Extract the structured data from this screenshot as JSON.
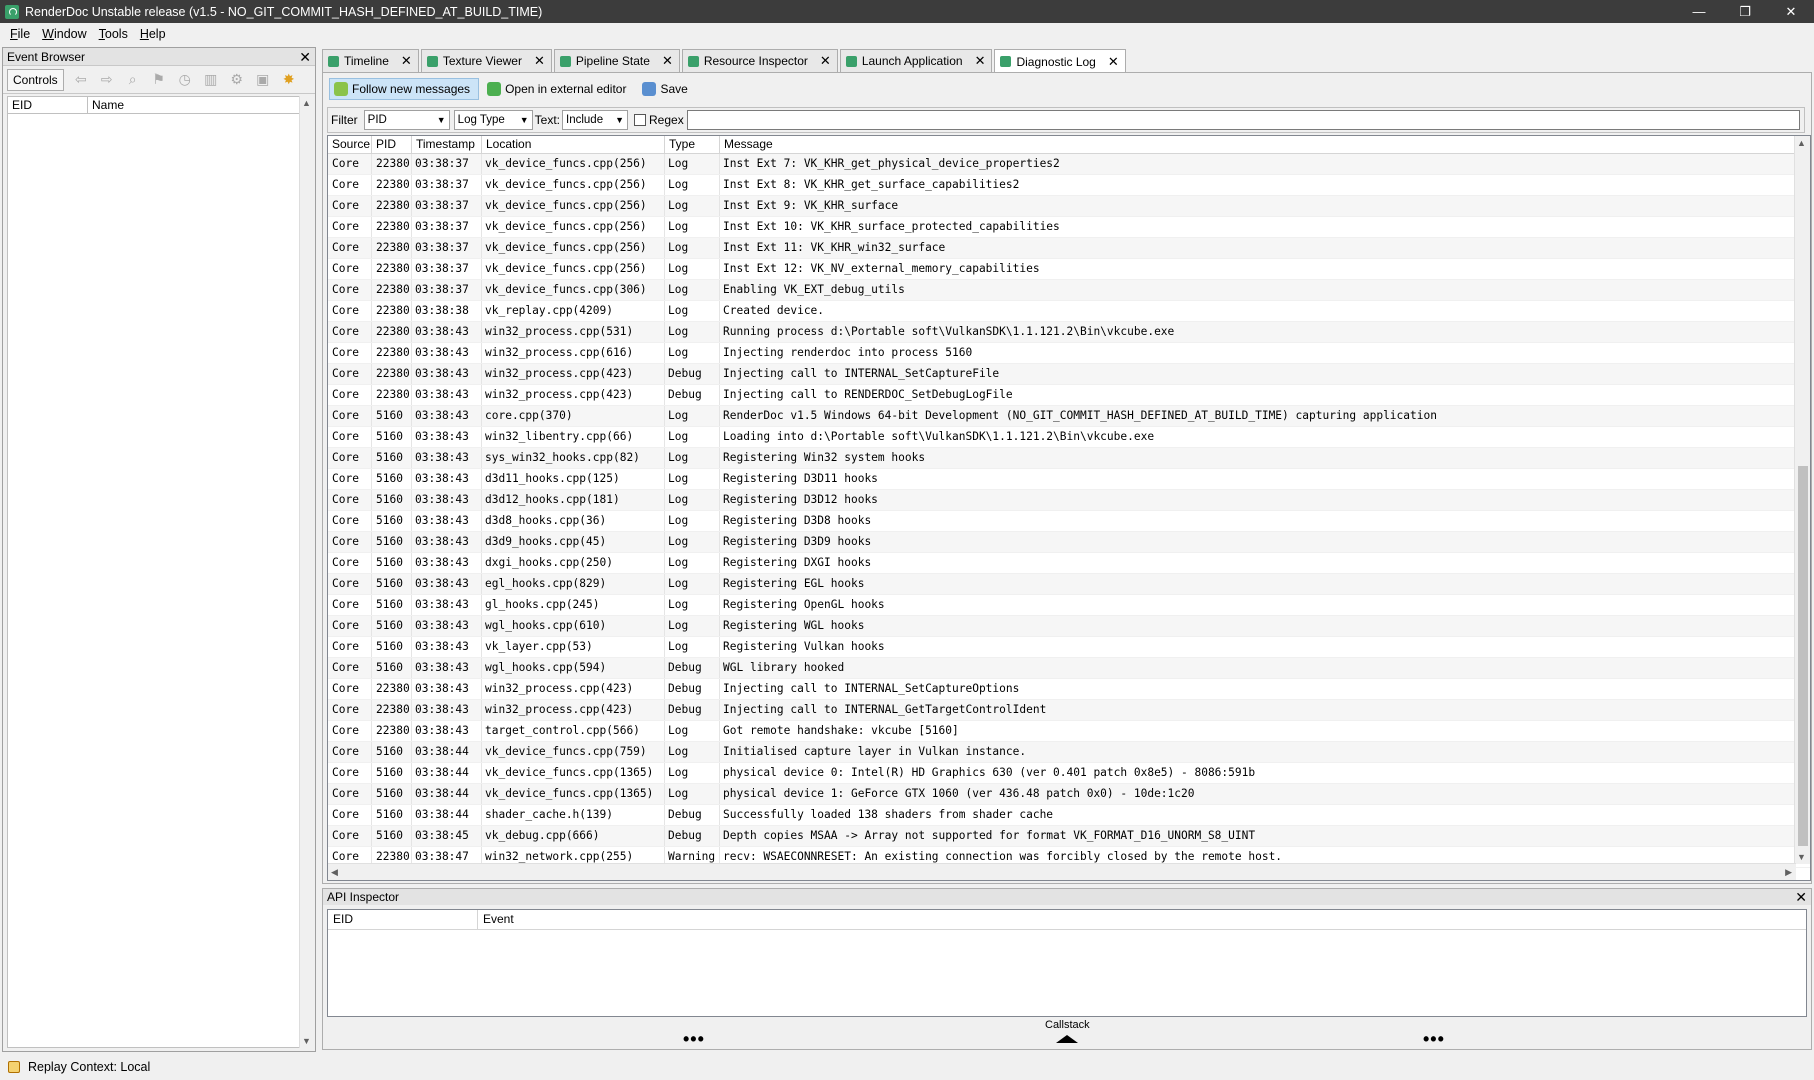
{
  "window": {
    "title": "RenderDoc Unstable release (v1.5 - NO_GIT_COMMIT_HASH_DEFINED_AT_BUILD_TIME)",
    "min": "—",
    "max": "❐",
    "close": "✕"
  },
  "menu": [
    "File",
    "Window",
    "Tools",
    "Help"
  ],
  "event_browser": {
    "title": "Event Browser",
    "controls_label": "Controls",
    "columns": [
      "EID",
      "Name"
    ]
  },
  "status": {
    "text": "Replay Context: Local"
  },
  "tabs": [
    {
      "label": "Timeline"
    },
    {
      "label": "Texture Viewer"
    },
    {
      "label": "Pipeline State"
    },
    {
      "label": "Resource Inspector"
    },
    {
      "label": "Launch Application"
    },
    {
      "label": "Diagnostic Log"
    }
  ],
  "toolbar": {
    "follow": "Follow new messages",
    "external": "Open in external editor",
    "save": "Save"
  },
  "filter": {
    "label": "Filter",
    "pid": "PID",
    "logtype": "Log Type",
    "text_label": "Text:",
    "include": "Include",
    "regex": "Regex"
  },
  "log": {
    "columns": [
      "Source",
      "PID",
      "Timestamp",
      "Location",
      "Type",
      "Message"
    ],
    "rows": [
      [
        "Core",
        "22380",
        "03:38:37",
        "vk_device_funcs.cpp(256)",
        "Log",
        "Inst Ext 7: VK_KHR_get_physical_device_properties2"
      ],
      [
        "Core",
        "22380",
        "03:38:37",
        "vk_device_funcs.cpp(256)",
        "Log",
        "Inst Ext 8: VK_KHR_get_surface_capabilities2"
      ],
      [
        "Core",
        "22380",
        "03:38:37",
        "vk_device_funcs.cpp(256)",
        "Log",
        "Inst Ext 9: VK_KHR_surface"
      ],
      [
        "Core",
        "22380",
        "03:38:37",
        "vk_device_funcs.cpp(256)",
        "Log",
        "Inst Ext 10: VK_KHR_surface_protected_capabilities"
      ],
      [
        "Core",
        "22380",
        "03:38:37",
        "vk_device_funcs.cpp(256)",
        "Log",
        "Inst Ext 11: VK_KHR_win32_surface"
      ],
      [
        "Core",
        "22380",
        "03:38:37",
        "vk_device_funcs.cpp(256)",
        "Log",
        "Inst Ext 12: VK_NV_external_memory_capabilities"
      ],
      [
        "Core",
        "22380",
        "03:38:37",
        "vk_device_funcs.cpp(306)",
        "Log",
        "Enabling VK_EXT_debug_utils"
      ],
      [
        "Core",
        "22380",
        "03:38:38",
        "vk_replay.cpp(4209)",
        "Log",
        "Created device."
      ],
      [
        "Core",
        "22380",
        "03:38:43",
        "win32_process.cpp(531)",
        "Log",
        "Running process d:\\Portable soft\\VulkanSDK\\1.1.121.2\\Bin\\vkcube.exe"
      ],
      [
        "Core",
        "22380",
        "03:38:43",
        "win32_process.cpp(616)",
        "Log",
        "Injecting renderdoc into process 5160"
      ],
      [
        "Core",
        "22380",
        "03:38:43",
        "win32_process.cpp(423)",
        "Debug",
        "Injecting call to INTERNAL_SetCaptureFile"
      ],
      [
        "Core",
        "22380",
        "03:38:43",
        "win32_process.cpp(423)",
        "Debug",
        "Injecting call to RENDERDOC_SetDebugLogFile"
      ],
      [
        "Core",
        "5160",
        "03:38:43",
        "core.cpp(370)",
        "Log",
        "RenderDoc v1.5 Windows 64-bit Development (NO_GIT_COMMIT_HASH_DEFINED_AT_BUILD_TIME) capturing application"
      ],
      [
        "Core",
        "5160",
        "03:38:43",
        "win32_libentry.cpp(66)",
        "Log",
        "Loading into d:\\Portable soft\\VulkanSDK\\1.1.121.2\\Bin\\vkcube.exe"
      ],
      [
        "Core",
        "5160",
        "03:38:43",
        "sys_win32_hooks.cpp(82)",
        "Log",
        "Registering Win32 system hooks"
      ],
      [
        "Core",
        "5160",
        "03:38:43",
        "d3d11_hooks.cpp(125)",
        "Log",
        "Registering D3D11 hooks"
      ],
      [
        "Core",
        "5160",
        "03:38:43",
        "d3d12_hooks.cpp(181)",
        "Log",
        "Registering D3D12 hooks"
      ],
      [
        "Core",
        "5160",
        "03:38:43",
        "d3d8_hooks.cpp(36)",
        "Log",
        "Registering D3D8 hooks"
      ],
      [
        "Core",
        "5160",
        "03:38:43",
        "d3d9_hooks.cpp(45)",
        "Log",
        "Registering D3D9 hooks"
      ],
      [
        "Core",
        "5160",
        "03:38:43",
        "dxgi_hooks.cpp(250)",
        "Log",
        "Registering DXGI hooks"
      ],
      [
        "Core",
        "5160",
        "03:38:43",
        "egl_hooks.cpp(829)",
        "Log",
        "Registering EGL hooks"
      ],
      [
        "Core",
        "5160",
        "03:38:43",
        "gl_hooks.cpp(245)",
        "Log",
        "Registering OpenGL hooks"
      ],
      [
        "Core",
        "5160",
        "03:38:43",
        "wgl_hooks.cpp(610)",
        "Log",
        "Registering WGL hooks"
      ],
      [
        "Core",
        "5160",
        "03:38:43",
        "vk_layer.cpp(53)",
        "Log",
        "Registering Vulkan hooks"
      ],
      [
        "Core",
        "5160",
        "03:38:43",
        "wgl_hooks.cpp(594)",
        "Debug",
        "WGL library hooked"
      ],
      [
        "Core",
        "22380",
        "03:38:43",
        "win32_process.cpp(423)",
        "Debug",
        "Injecting call to INTERNAL_SetCaptureOptions"
      ],
      [
        "Core",
        "22380",
        "03:38:43",
        "win32_process.cpp(423)",
        "Debug",
        "Injecting call to INTERNAL_GetTargetControlIdent"
      ],
      [
        "Core",
        "22380",
        "03:38:43",
        "target_control.cpp(566)",
        "Log",
        "Got remote handshake: vkcube [5160]"
      ],
      [
        "Core",
        "5160",
        "03:38:44",
        "vk_device_funcs.cpp(759)",
        "Log",
        "Initialised capture layer in Vulkan instance."
      ],
      [
        "Core",
        "5160",
        "03:38:44",
        "vk_device_funcs.cpp(1365)",
        "Log",
        "physical device 0: Intel(R) HD Graphics 630 (ver 0.401 patch 0x8e5) - 8086:591b"
      ],
      [
        "Core",
        "5160",
        "03:38:44",
        "vk_device_funcs.cpp(1365)",
        "Log",
        "physical device 1: GeForce GTX 1060 (ver 436.48 patch 0x0) - 10de:1c20"
      ],
      [
        "Core",
        "5160",
        "03:38:44",
        "shader_cache.h(139)",
        "Debug",
        "Successfully loaded 138 shaders from shader cache"
      ],
      [
        "Core",
        "5160",
        "03:38:45",
        "vk_debug.cpp(666)",
        "Debug",
        "Depth copies MSAA -> Array not supported for format VK_FORMAT_D16_UNORM_S8_UINT"
      ],
      [
        "Core",
        "22380",
        "03:38:47",
        "win32_network.cpp(255)",
        "Warning",
        "recv: WSAECONNRESET: An existing connection was forcibly closed by the remote host."
      ]
    ]
  },
  "api_inspector": {
    "title": "API Inspector",
    "columns": [
      "EID",
      "Event"
    ],
    "callstack": "Callstack",
    "dots": "•••"
  },
  "colors": {
    "titlebar": "#3c3c3c",
    "accent": "#3aa06a",
    "pressed": "#cce4f7"
  }
}
